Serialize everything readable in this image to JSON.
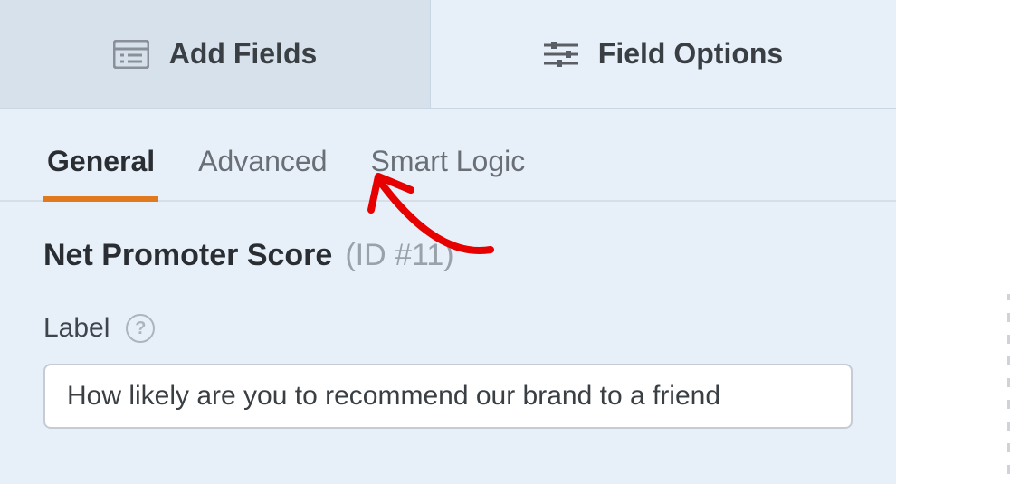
{
  "topTabs": {
    "addFields": "Add Fields",
    "fieldOptions": "Field Options"
  },
  "subTabs": {
    "general": "General",
    "advanced": "Advanced",
    "smartLogic": "Smart Logic"
  },
  "field": {
    "type": "Net Promoter Score",
    "idLabel": "(ID #11)"
  },
  "labelSection": {
    "label": "Label",
    "help": "?",
    "value": "How likely are you to recommend our brand to a friend"
  }
}
